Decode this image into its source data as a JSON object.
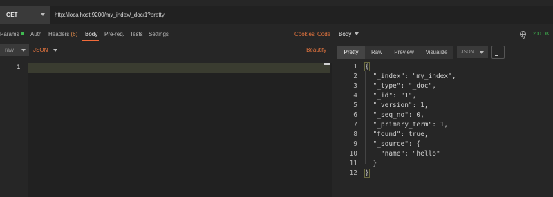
{
  "request": {
    "method": "GET",
    "url": "http://localhost:9200/my_index/_doc/1?pretty"
  },
  "request_tabs": {
    "params": "Params",
    "auth": "Auth",
    "headers": "Headers",
    "headers_count": "(6)",
    "body": "Body",
    "prereq": "Pre-req.",
    "tests": "Tests",
    "settings": "Settings",
    "cookies": "Cookies",
    "code": "Code"
  },
  "body_options": {
    "mode": "raw",
    "language": "JSON",
    "beautify": "Beautify"
  },
  "editor": {
    "line_number": "1"
  },
  "response": {
    "label": "Body",
    "status": "200 OK",
    "view_tabs": [
      "Pretty",
      "Raw",
      "Preview",
      "Visualize"
    ],
    "format": "JSON",
    "lines": [
      {
        "n": "1",
        "text": "{"
      },
      {
        "n": "2",
        "text": "  \"_index\": \"my_index\","
      },
      {
        "n": "3",
        "text": "  \"_type\": \"_doc\","
      },
      {
        "n": "4",
        "text": "  \"_id\": \"1\","
      },
      {
        "n": "5",
        "text": "  \"_version\": 1,"
      },
      {
        "n": "6",
        "text": "  \"_seq_no\": 0,"
      },
      {
        "n": "7",
        "text": "  \"_primary_term\": 1,"
      },
      {
        "n": "8",
        "text": "  \"found\": true,"
      },
      {
        "n": "9",
        "text": "  \"_source\": {"
      },
      {
        "n": "10",
        "text": "    \"name\": \"hello\""
      },
      {
        "n": "11",
        "text": "  }"
      },
      {
        "n": "12",
        "text": "}"
      }
    ]
  },
  "colors": {
    "accent": "#f26b3a",
    "status_ok": "#3fb950",
    "background": "#262626"
  }
}
